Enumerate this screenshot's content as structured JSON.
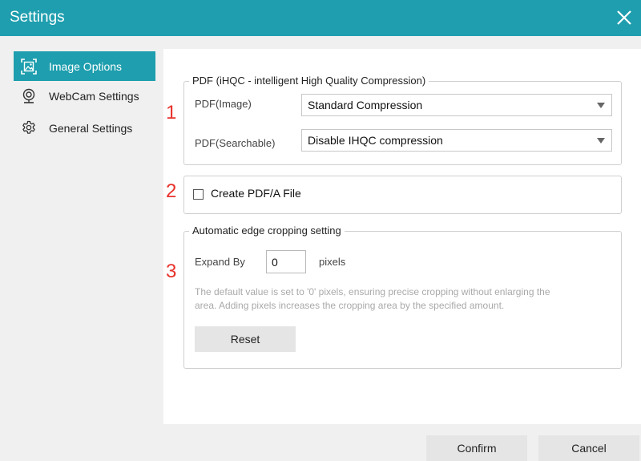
{
  "window": {
    "title": "Settings"
  },
  "sidebar": {
    "items": [
      {
        "label": "Image Options",
        "icon": "image-icon",
        "active": true
      },
      {
        "label": "WebCam Settings",
        "icon": "webcam-icon",
        "active": false
      },
      {
        "label": "General Settings",
        "icon": "gear-icon",
        "active": false
      }
    ]
  },
  "markers": [
    "1",
    "2",
    "3"
  ],
  "pdf_group": {
    "legend": "PDF (iHQC - intelligent High Quality Compression)",
    "image_label": "PDF(Image)",
    "image_value": "Standard Compression",
    "searchable_label": "PDF(Searchable)",
    "searchable_value": "Disable IHQC compression"
  },
  "pdfa": {
    "label": "Create PDF/A File",
    "checked": false
  },
  "crop_group": {
    "legend": "Automatic edge cropping setting",
    "expand_label": "Expand By",
    "expand_value": "0",
    "unit": "pixels",
    "hint_line1": "The default value is set to '0' pixels, ensuring precise cropping without enlarging the",
    "hint_line2": "area. Adding pixels increases the cropping area by the specified amount.",
    "reset_label": "Reset"
  },
  "footer": {
    "confirm_label": "Confirm",
    "cancel_label": "Cancel"
  },
  "colors": {
    "accent": "#1e9eae",
    "marker": "#e8322b"
  }
}
